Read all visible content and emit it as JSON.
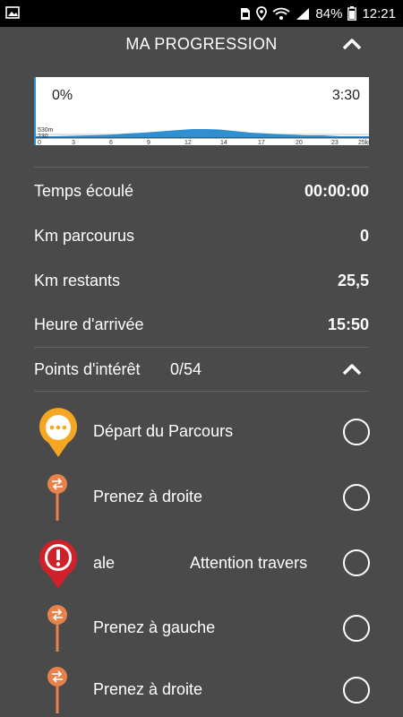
{
  "status_bar": {
    "battery": "84%",
    "time": "12:21"
  },
  "header": {
    "title": "MA PROGRESSION"
  },
  "profile": {
    "progress_percent_label": "0%",
    "duration_label": "3:30",
    "altitude_max_label": "530m",
    "altitude_min_label": "230",
    "distance_ticks": [
      "0",
      "3",
      "6",
      "9",
      "12",
      "14",
      "17",
      "20",
      "23",
      "25km"
    ],
    "color_fill": "#2f8fd0"
  },
  "stats": {
    "elapsed_label": "Temps écoulé",
    "elapsed_value": "00:00:00",
    "km_done_label": "Km parcourus",
    "km_done_value": "0",
    "km_left_label": "Km restants",
    "km_left_value": "25,5",
    "arrival_label": "Heure d'arrivée",
    "arrival_value": "15:50"
  },
  "poi": {
    "title": "Points d'intérêt",
    "count": "0/54",
    "items": [
      {
        "label": "Départ du Parcours",
        "icon": "start-pin-icon",
        "checked": false
      },
      {
        "label": "Prenez à droite",
        "icon": "direction-marker-icon",
        "checked": false
      },
      {
        "label_left": "ale",
        "label_right": "Attention travers",
        "icon": "warning-pin-icon",
        "checked": false
      },
      {
        "label": "Prenez à gauche",
        "icon": "direction-marker-icon",
        "checked": false
      },
      {
        "label": "Prenez à droite",
        "icon": "direction-marker-icon",
        "checked": false
      }
    ]
  },
  "colors": {
    "background": "#4a4a4a",
    "status_bar": "#000000",
    "start_pin": "#f5a623",
    "warning_pin": "#d0202a",
    "direction_marker": "#e8824a"
  }
}
